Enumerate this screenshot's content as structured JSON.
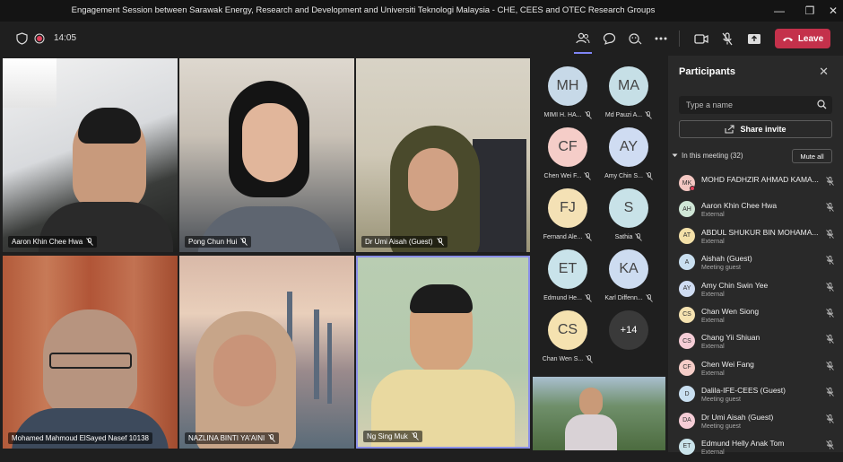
{
  "window": {
    "title": "Engagement Session between Sarawak Energy, Research and Development and Universiti Teknologi Malaysia - CHE, CEES and OTEC Research Groups",
    "minimize": "—",
    "maximize": "❐",
    "close": "✕"
  },
  "toolbar": {
    "time": "14:05",
    "leave_label": "Leave"
  },
  "video_tiles": [
    {
      "name": "Aaron Khin Chee Hwa"
    },
    {
      "name": "Pong Chun Hui"
    },
    {
      "name": "Dr Umi Aisah (Guest)"
    },
    {
      "name": "Mohamed Mahmoud ElSayed Nasef 10138"
    },
    {
      "name": "NAZLINA BINTI YA'AINI"
    },
    {
      "name": "Ng Sing Muk"
    },
    {
      "name": ""
    }
  ],
  "avatar_grid": [
    {
      "initials": "MH",
      "label": "MIMI H. HA...",
      "color": "#c7d9e8"
    },
    {
      "initials": "MA",
      "label": "Md Pauzi A...",
      "color": "#c6dfe6"
    },
    {
      "initials": "CF",
      "label": "Chen Wei F...",
      "color": "#f5cdc8"
    },
    {
      "initials": "AY",
      "label": "Amy Chin S...",
      "color": "#cfdcf2"
    },
    {
      "initials": "FJ",
      "label": "Fernand Ale...",
      "color": "#f4e1b5"
    },
    {
      "initials": "S",
      "label": "Sathia",
      "color": "#c8e2e8"
    },
    {
      "initials": "ET",
      "label": "Edmund He...",
      "color": "#c9e3ea"
    },
    {
      "initials": "KA",
      "label": "Karl Diffenn...",
      "color": "#cddcf0"
    },
    {
      "initials": "CS",
      "label": "Chan Wen S...",
      "color": "#f5e2b0"
    },
    {
      "initials": "+14",
      "label": "",
      "color": "#3a3a3a"
    }
  ],
  "participants_panel": {
    "title": "Participants",
    "search_placeholder": "Type a name",
    "share_invite": "Share invite",
    "in_meeting": "In this meeting (32)",
    "mute_all": "Mute all",
    "people": [
      {
        "initials": "MK",
        "name": "MOHD FADHZIR AHMAD KAMA...",
        "sub": "",
        "color": "#f3c7c2"
      },
      {
        "initials": "AH",
        "name": "Aaron Khin Chee Hwa",
        "sub": "External",
        "color": "#cfe6d6"
      },
      {
        "initials": "AT",
        "name": "ABDUL SHUKUR BIN MOHAMA...",
        "sub": "External",
        "color": "#f3e0a8"
      },
      {
        "initials": "A",
        "name": "Aishah (Guest)",
        "sub": "Meeting guest",
        "color": "#c9dff0"
      },
      {
        "initials": "AY",
        "name": "Amy Chin Swin Yee",
        "sub": "External",
        "color": "#cfdcf2"
      },
      {
        "initials": "CS",
        "name": "Chan Wen Siong",
        "sub": "External",
        "color": "#f5e2b0"
      },
      {
        "initials": "CS",
        "name": "Chang Yii Shiuan",
        "sub": "External",
        "color": "#f5cdd6"
      },
      {
        "initials": "CF",
        "name": "Chen Wei Fang",
        "sub": "External",
        "color": "#f5cdc8"
      },
      {
        "initials": "D",
        "name": "Dalila-IFE-CEES (Guest)",
        "sub": "Meeting guest",
        "color": "#c9dff0"
      },
      {
        "initials": "DA",
        "name": "Dr Umi Aisah (Guest)",
        "sub": "Meeting guest",
        "color": "#f5cdd6"
      },
      {
        "initials": "ET",
        "name": "Edmund Helly Anak Tom",
        "sub": "External",
        "color": "#c9e3ea"
      }
    ]
  }
}
